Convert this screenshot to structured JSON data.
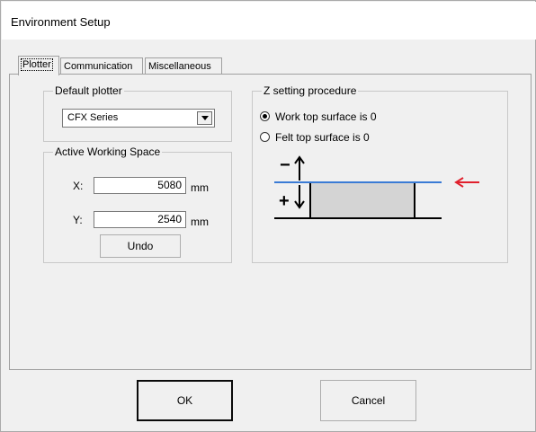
{
  "window": {
    "title": "Environment Setup"
  },
  "tabs": [
    {
      "label": "Plotter",
      "active": true
    },
    {
      "label": "Communication",
      "active": false
    },
    {
      "label": "Miscellaneous",
      "active": false
    }
  ],
  "default_plotter": {
    "group_label": "Default plotter",
    "selected": "CFX Series"
  },
  "working_space": {
    "group_label": "Active Working Space",
    "x_label": "X:",
    "x_value": "5080",
    "y_label": "Y:",
    "y_value": "2540",
    "unit": "mm",
    "undo_label": "Undo"
  },
  "z_setting": {
    "group_label": "Z setting procedure",
    "options": [
      {
        "label": "Work top surface is 0",
        "selected": true
      },
      {
        "label": "Felt top surface is 0",
        "selected": false
      }
    ],
    "diagram": {
      "minus": "−",
      "plus": "+"
    }
  },
  "footer": {
    "ok_label": "OK",
    "cancel_label": "Cancel"
  },
  "colors": {
    "surface_line": "#3a7bd5",
    "arrow": "#e0202c",
    "block_fill": "#d4d4d4"
  }
}
